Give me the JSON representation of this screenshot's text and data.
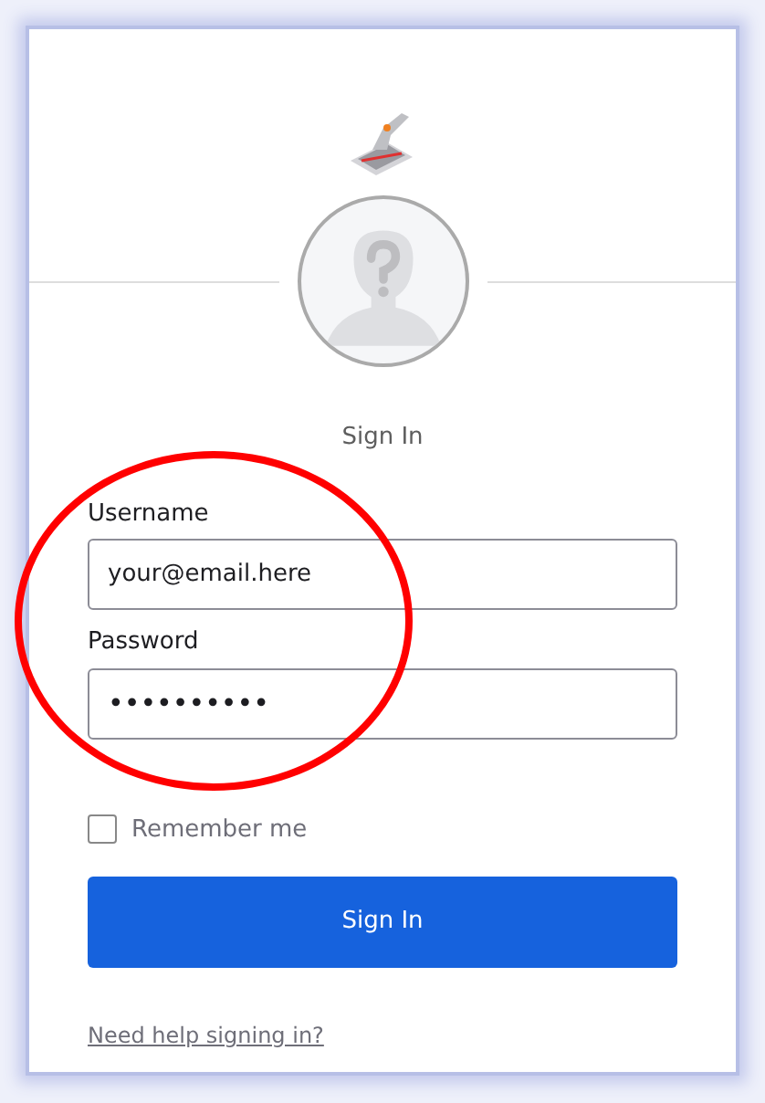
{
  "title": "Sign In",
  "username": {
    "label": "Username",
    "value": "your@email.here"
  },
  "password": {
    "label": "Password",
    "value": "••••••••••"
  },
  "remember": {
    "label": "Remember me",
    "checked": false
  },
  "submit": "Sign In",
  "help_link": "Need help signing in?"
}
